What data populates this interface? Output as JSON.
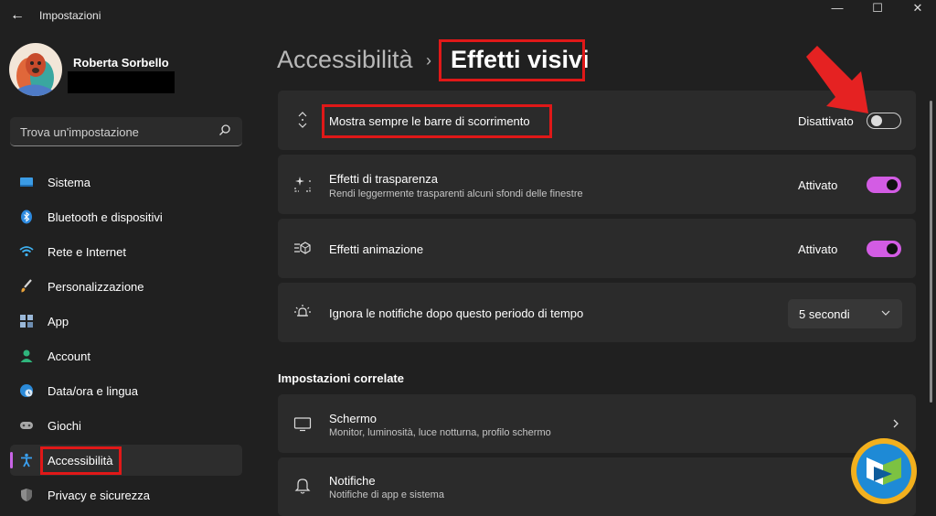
{
  "window": {
    "title": "Impostazioni",
    "minimize_glyph": "—",
    "maximize_glyph": "☐",
    "close_glyph": "✕",
    "back_glyph": "←"
  },
  "profile": {
    "name": "Roberta Sorbello"
  },
  "search": {
    "placeholder": "Trova un'impostazione"
  },
  "sidebar": {
    "items": [
      {
        "label": "Sistema",
        "icon": "monitor-icon"
      },
      {
        "label": "Bluetooth e dispositivi",
        "icon": "bluetooth-icon"
      },
      {
        "label": "Rete e Internet",
        "icon": "wifi-icon"
      },
      {
        "label": "Personalizzazione",
        "icon": "brush-icon"
      },
      {
        "label": "App",
        "icon": "apps-icon"
      },
      {
        "label": "Account",
        "icon": "person-icon"
      },
      {
        "label": "Data/ora e lingua",
        "icon": "globe-clock-icon"
      },
      {
        "label": "Giochi",
        "icon": "gamepad-icon"
      },
      {
        "label": "Accessibilità",
        "icon": "accessibility-icon",
        "active": true
      },
      {
        "label": "Privacy e sicurezza",
        "icon": "shield-icon"
      }
    ]
  },
  "header": {
    "breadcrumb_parent": "Accessibilità",
    "separator": "›",
    "page_title": "Effetti visivi"
  },
  "settings": [
    {
      "title": "Mostra sempre le barre di scorrimento",
      "state": "Disattivato",
      "on": false,
      "icon": "scroll-arrows-icon"
    },
    {
      "title": "Effetti di trasparenza",
      "subtitle": "Rendi leggermente trasparenti alcuni sfondi delle finestre",
      "state": "Attivato",
      "on": true,
      "icon": "transparency-sparkle-icon"
    },
    {
      "title": "Effetti animazione",
      "state": "Attivato",
      "on": true,
      "icon": "animation-icon"
    },
    {
      "title": "Ignora le notifiche dopo questo periodo di tempo",
      "dropdown_value": "5 secondi",
      "icon": "notification-timer-icon"
    }
  ],
  "related": {
    "heading": "Impostazioni correlate",
    "items": [
      {
        "title": "Schermo",
        "subtitle": "Monitor, luminosità, luce notturna, profilo schermo",
        "icon": "display-icon"
      },
      {
        "title": "Notifiche",
        "subtitle": "Notifiche di app e sistema",
        "icon": "bell-icon"
      }
    ]
  },
  "colors": {
    "background": "#202020",
    "card": "#2b2b2b",
    "accent": "#d35ce4",
    "annotation": "#e01818"
  }
}
